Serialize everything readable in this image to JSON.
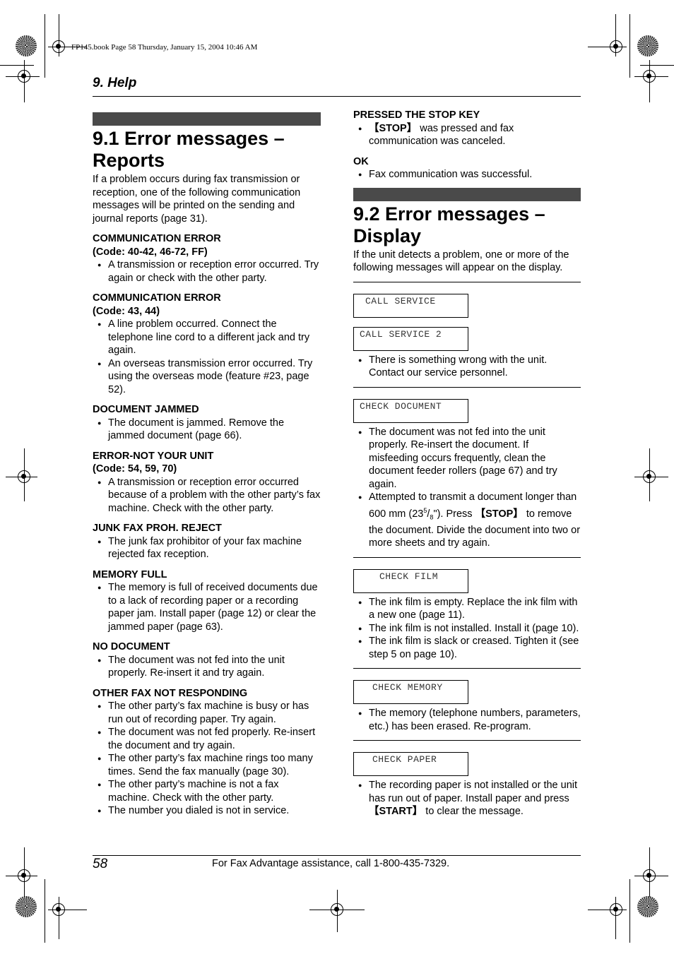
{
  "print_header": "FP145.book  Page 58  Thursday, January 15, 2004  10:46 AM",
  "section_header": "9. Help",
  "left": {
    "title_line1": "9.1 Error messages –",
    "title_line2": "Reports",
    "intro": "If a problem occurs during fax transmission or reception, one of the following communication messages will be printed on the sending and journal reports (page 31).",
    "items": [
      {
        "label": "COMMUNICATION ERROR",
        "code": "(Code: 40-42, 46-72, FF)",
        "bullets": [
          "A transmission or reception error occurred. Try again or check with the other party."
        ]
      },
      {
        "label": "COMMUNICATION ERROR",
        "code": "(Code: 43, 44)",
        "bullets": [
          "A line problem occurred. Connect the telephone line cord to a different jack and try again.",
          "An overseas transmission error occurred. Try using the overseas mode (feature #23, page 52)."
        ]
      },
      {
        "label": "DOCUMENT JAMMED",
        "code": null,
        "bullets": [
          "The document is jammed. Remove the jammed document (page 66)."
        ]
      },
      {
        "label": "ERROR-NOT YOUR UNIT",
        "code": "(Code: 54, 59, 70)",
        "bullets": [
          "A transmission or reception error occurred because of a problem with the other party’s fax machine. Check with the other party."
        ]
      },
      {
        "label": "JUNK FAX PROH. REJECT",
        "code": null,
        "bullets": [
          "The junk fax prohibitor of your fax machine rejected fax reception."
        ]
      },
      {
        "label": "MEMORY FULL",
        "code": null,
        "bullets": [
          "The memory is full of received documents due to a lack of recording paper or a recording paper jam. Install paper (page 12) or clear the jammed paper (page 63)."
        ]
      },
      {
        "label": "NO DOCUMENT",
        "code": null,
        "bullets": [
          "The document was not fed into the unit properly. Re-insert it and try again."
        ]
      },
      {
        "label": "OTHER FAX NOT RESPONDING",
        "code": null,
        "bullets": [
          "The other party’s fax machine is busy or has run out of recording paper. Try again.",
          "The document was not fed properly. Re-insert the document and try again.",
          "The other party’s fax machine rings too many times. Send the fax manually (page 30).",
          "The other party’s machine is not a fax machine. Check with the other party.",
          "The number you dialed is not in service."
        ]
      }
    ]
  },
  "right": {
    "stop_label": "PRESSED THE STOP KEY",
    "stop_key": "【STOP】",
    "stop_text": " was pressed and fax communication was canceled.",
    "ok_label": "OK",
    "ok_text": "Fax communication was successful.",
    "title_line1": "9.2 Error messages –",
    "title_line2": "Display",
    "intro": "If the unit detects a problem, one or more of the following messages will appear on the display.",
    "call_service": "CALL SERVICE",
    "call_service_2": "CALL SERVICE 2",
    "call_service_text": "There is something wrong with the unit. Contact our service personnel.",
    "check_document": "CHECK DOCUMENT",
    "check_document_b1": "The document was not fed into the unit properly. Re-insert the document. If misfeeding occurs frequently, clean the document feeder rollers (page 67) and try again.",
    "check_document_b2_a": "Attempted to transmit a document longer than 600 mm (23",
    "check_document_b2_sup": "5",
    "check_document_b2_slash": "/",
    "check_document_b2_sub": "8",
    "check_document_b2_b": "\"). Press ",
    "check_document_b2_key": "【STOP】",
    "check_document_b2_c": " to remove the document. Divide the document into two or more sheets and try again.",
    "check_film": "CHECK FILM",
    "check_film_bullets": [
      "The ink film is empty. Replace the ink film with a new one (page 11).",
      "The ink film is not installed. Install it (page 10).",
      "The ink film is slack or creased. Tighten it (see step 5 on page 10)."
    ],
    "check_memory": "CHECK MEMORY",
    "check_memory_text": "The memory (telephone numbers, parameters, etc.) has been erased. Re-program.",
    "check_paper": "CHECK PAPER",
    "check_paper_a": "The recording paper is not installed or the unit has run out of paper. Install paper and press ",
    "check_paper_key": "【START】",
    "check_paper_b": " to clear the message."
  },
  "footer": {
    "page_number": "58",
    "assistance": "For Fax Advantage assistance, call 1-800-435-7329."
  }
}
